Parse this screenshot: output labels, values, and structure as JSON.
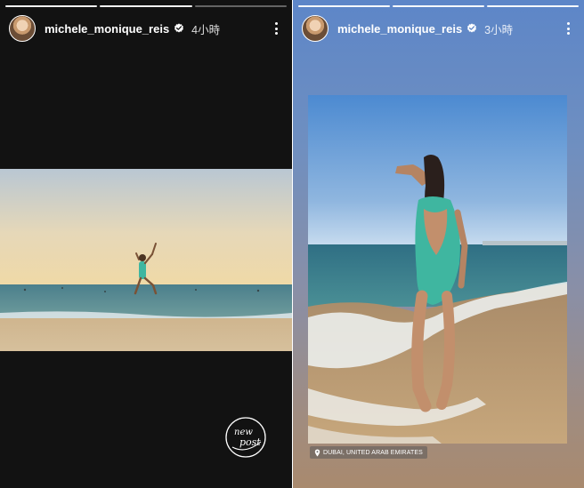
{
  "left_story": {
    "username": "michele_monique_reis",
    "time": "4小時",
    "progress_segments": 3,
    "progress_done": 2,
    "icons": {
      "verified": "verified-badge-icon",
      "more": "more-options-icon",
      "sticker": "new-post-sticker"
    },
    "sticker_text": [
      "new",
      "post"
    ]
  },
  "right_story": {
    "username": "michele_monique_reis",
    "time": "3小時",
    "progress_segments": 3,
    "progress_done": 3,
    "location": "DUBAI, UNITED ARAB EMIRATES",
    "icons": {
      "verified": "verified-badge-icon",
      "more": "more-options-icon",
      "location": "location-pin-icon"
    }
  },
  "colors": {
    "left_background": "#121212",
    "right_gradient_top": "#5d86c8",
    "right_gradient_bottom": "#a98a6e",
    "swimsuit": "#3fb6a0"
  }
}
